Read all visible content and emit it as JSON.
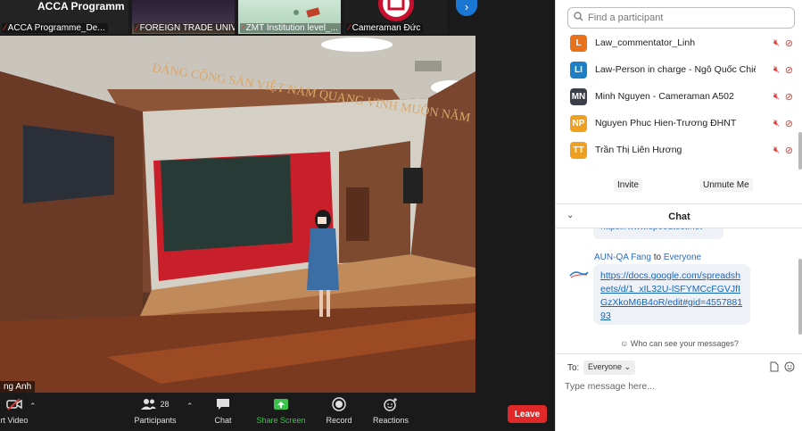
{
  "thumbnails": [
    {
      "title": "ACCA  Programm",
      "name": "ACCA Programme_De..."
    },
    {
      "name": "FOREIGN TRADE UNIVE..."
    },
    {
      "name": "ZMT Institution level_..."
    },
    {
      "name": "Cameraman Đức"
    }
  ],
  "main_video": {
    "speaker_label": "ng Anh"
  },
  "toolbar": {
    "video_label": "rt Video",
    "participants_label": "Participants",
    "participants_count": "28",
    "chat_label": "Chat",
    "share_label": "Share Screen",
    "record_label": "Record",
    "reactions_label": "Reactions",
    "leave_label": "Leave"
  },
  "side_panel": {
    "search_placeholder": "Find a participant",
    "participants": [
      {
        "initials": "L",
        "name": "Law_commentator_Linh",
        "color": "#e8711c"
      },
      {
        "initials": "LI",
        "name": "Law-Person in charge - Ngô Quốc Chiến",
        "color": "#1f7fc4"
      },
      {
        "initials": "MN",
        "name": "Minh Nguyen - Cameraman A502",
        "color": "#3a3f4a"
      },
      {
        "initials": "NP",
        "name": "Nguyen Phuc Hien-Trương ĐHNT",
        "color": "#f0a020"
      },
      {
        "initials": "TT",
        "name": "Trần Thị Liên Hương",
        "color": "#f0a020"
      }
    ],
    "invite_label": "Invite",
    "unmute_label": "Unmute Me",
    "chat_title": "Chat",
    "chat": {
      "previous_link": "https://www.speedtest.net",
      "sender": "AUN-QA Fang",
      "to_word": "to",
      "recipient": "Everyone",
      "message": "https://docs.google.com/spreadsheets/d/1_xIL32U-lSFYMCcFGVJfIGzXkoM6B4oR/edit#gid=455788193"
    },
    "who_can_see": "Who can see your messages?",
    "to_label": "To:",
    "to_value": "Everyone",
    "message_placeholder": "Type message here..."
  }
}
